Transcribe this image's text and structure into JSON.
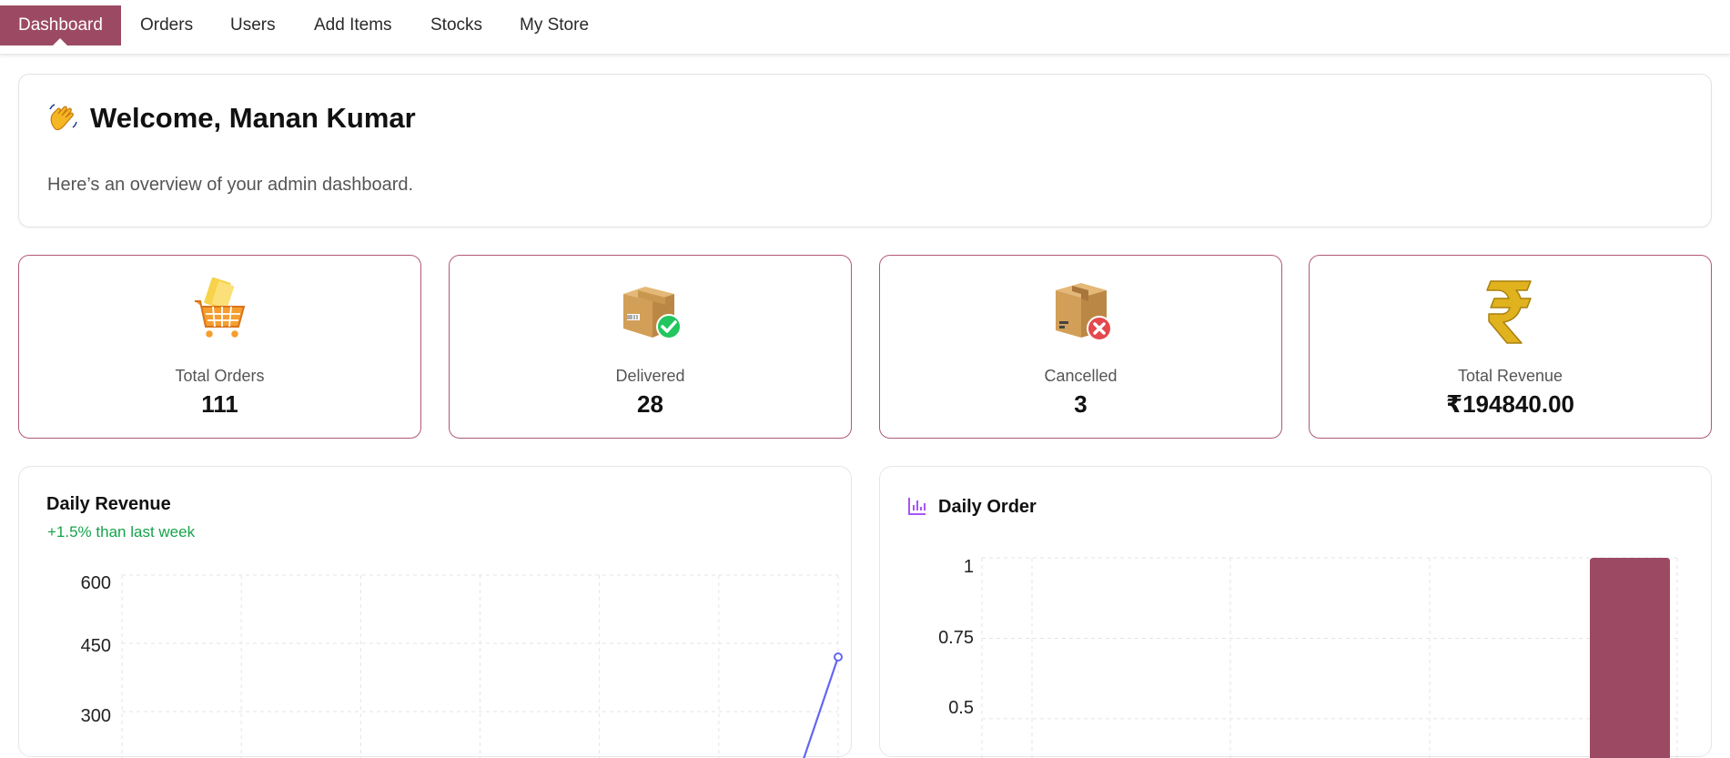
{
  "nav": {
    "items": [
      {
        "label": "Dashboard",
        "active": true
      },
      {
        "label": "Orders"
      },
      {
        "label": "Users"
      },
      {
        "label": "Add Items"
      },
      {
        "label": "Stocks"
      },
      {
        "label": "My Store"
      }
    ]
  },
  "welcome": {
    "title": "Welcome, Manan Kumar",
    "subtitle": "Here’s an overview of your admin dashboard.",
    "icon": "waving-hand-icon"
  },
  "stats": [
    {
      "label": "Total Orders",
      "value": "111",
      "icon": "shopping-cart-icon"
    },
    {
      "label": "Delivered",
      "value": "28",
      "icon": "package-delivered-icon"
    },
    {
      "label": "Cancelled",
      "value": "3",
      "icon": "package-cancelled-icon"
    },
    {
      "label": "Total Revenue",
      "value": "₹194840.00",
      "icon": "rupee-icon"
    }
  ],
  "colors": {
    "accent": "#9c4a63",
    "card_border": "#b05a74",
    "line": "#6366f1",
    "positive": "#16a34a",
    "chart_icon": "#a855f7"
  },
  "chart_data": [
    {
      "type": "line",
      "title": "Daily Revenue",
      "subtitle": "+1.5% than last week",
      "y_ticks": [
        "600",
        "450",
        "300"
      ],
      "ylim": [
        150,
        600
      ],
      "grid": true,
      "points_visible": [
        {
          "x_index": 6,
          "y": 420
        }
      ],
      "series_color": "#6366f1"
    },
    {
      "type": "bar",
      "title": "Daily Order",
      "y_ticks": [
        "1",
        "0.75",
        "0.5"
      ],
      "ylim": [
        0.35,
        1
      ],
      "grid": true,
      "values_visible": [
        {
          "x_index": 3,
          "value": 1
        }
      ],
      "bar_color": "#9c4a63"
    }
  ]
}
